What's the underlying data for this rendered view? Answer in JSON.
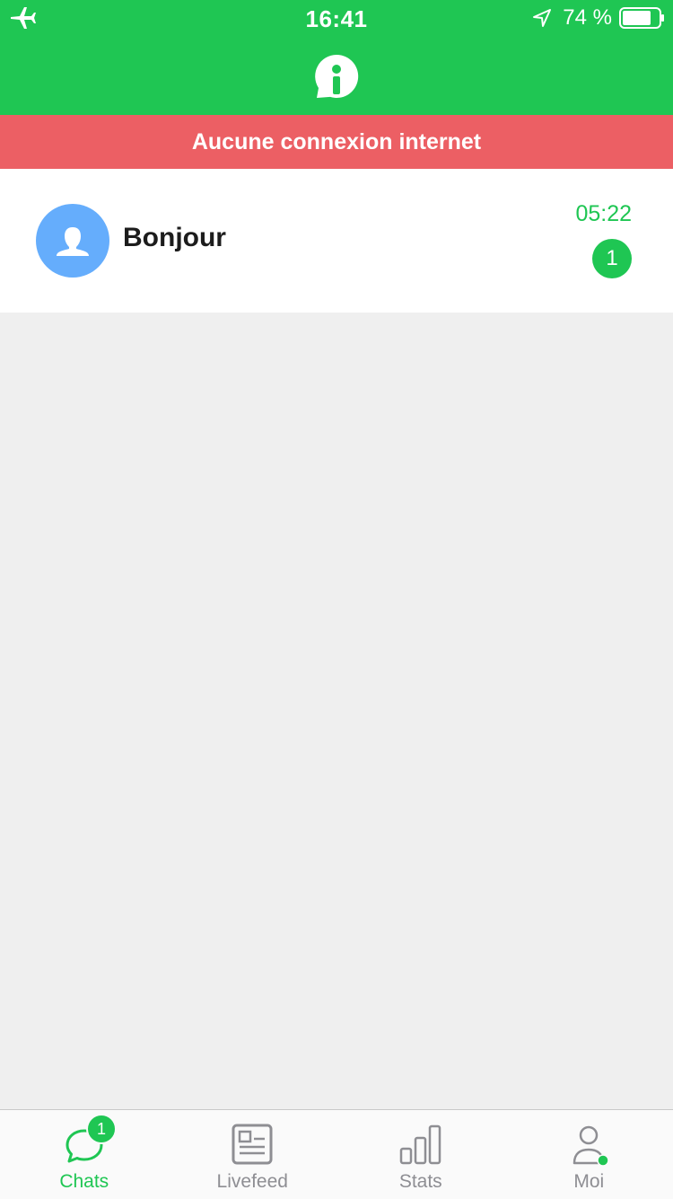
{
  "status_bar": {
    "time": "16:41",
    "battery_text": "74 %",
    "icons": [
      "airplane-icon",
      "location-arrow-icon",
      "battery-icon"
    ]
  },
  "header": {
    "logo_icon": "info-chat-logo-icon"
  },
  "banner": {
    "text": "Aucune connexion internet",
    "color": "#ec5f64"
  },
  "chats": [
    {
      "name": "Bonjour",
      "time": "05:22",
      "unread": "1",
      "avatar_icon": "user-silhouette-icon"
    }
  ],
  "tabs": [
    {
      "label": "Chats",
      "icon": "chat-bubble-icon",
      "badge": "1",
      "active": true
    },
    {
      "label": "Livefeed",
      "icon": "newspaper-icon",
      "active": false
    },
    {
      "label": "Stats",
      "icon": "bar-chart-icon",
      "active": false
    },
    {
      "label": "Moi",
      "icon": "user-icon",
      "active": false
    }
  ],
  "colors": {
    "brand": "#1fc653",
    "banner": "#ec5f64",
    "avatar": "#65adfc"
  }
}
